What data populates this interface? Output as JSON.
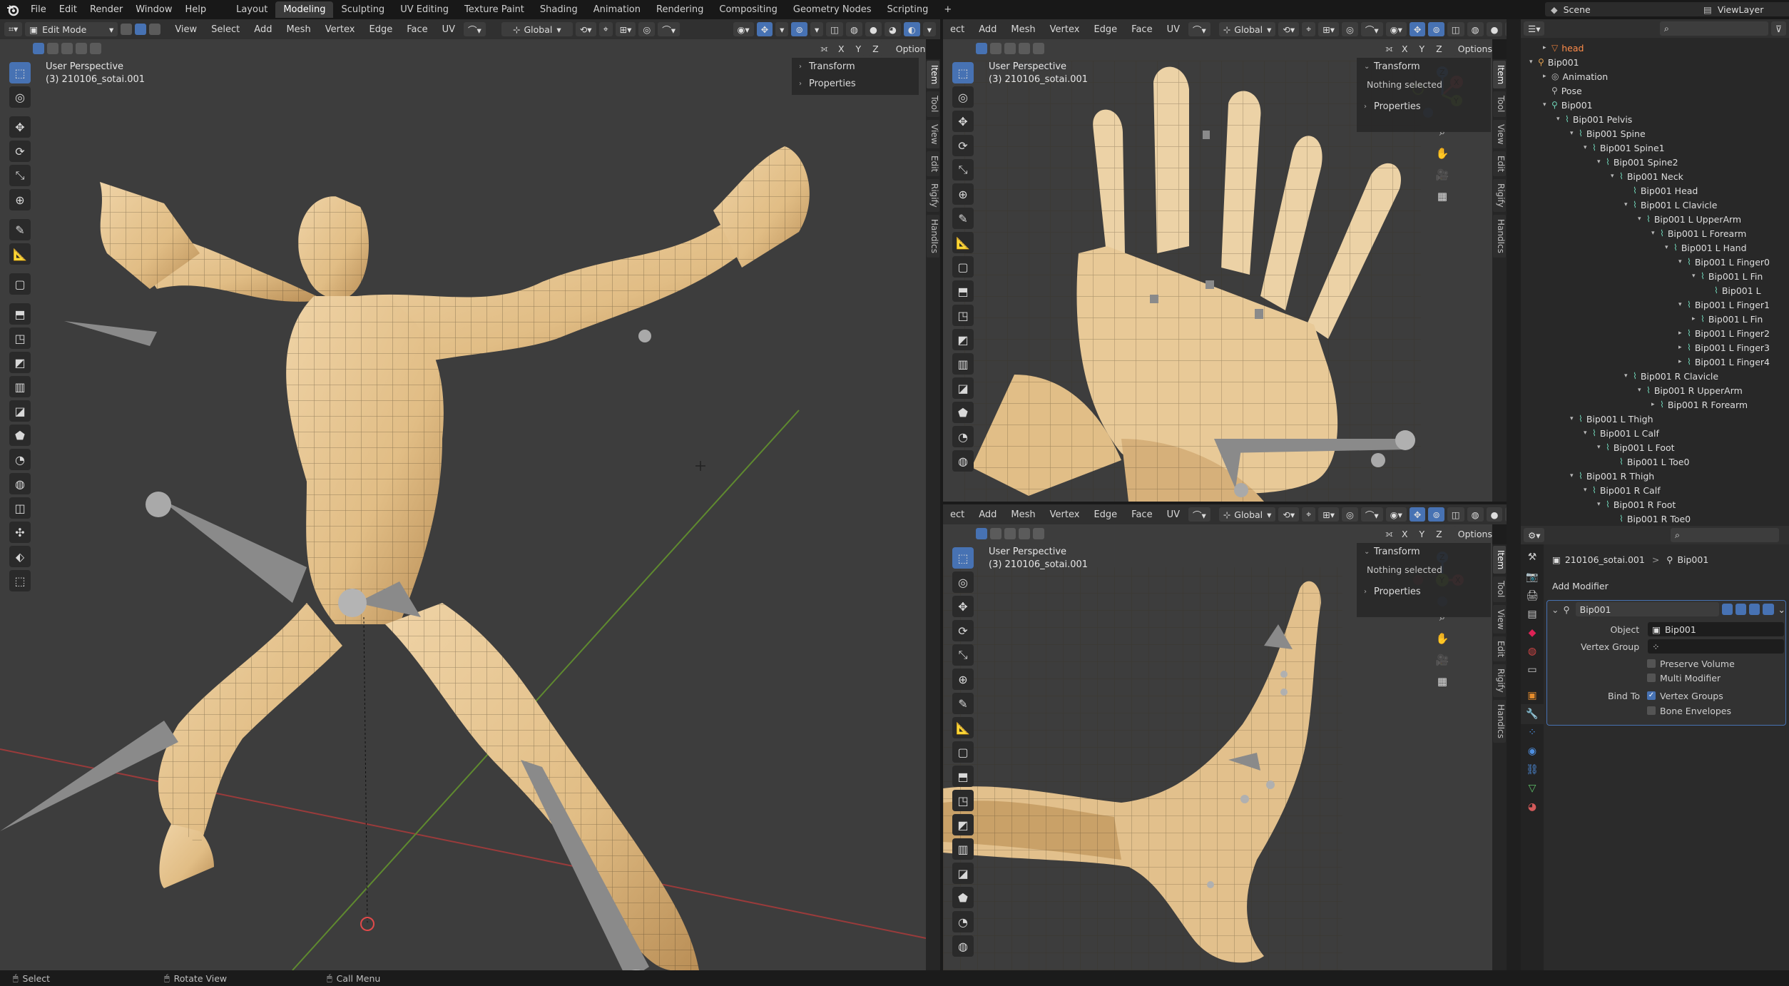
{
  "topbar": {
    "menus": [
      "File",
      "Edit",
      "Render",
      "Window",
      "Help"
    ],
    "workspaces": [
      "Layout",
      "Modeling",
      "Sculpting",
      "UV Editing",
      "Texture Paint",
      "Shading",
      "Animation",
      "Rendering",
      "Compositing",
      "Geometry Nodes",
      "Scripting"
    ],
    "active_workspace": "Modeling",
    "add_tab": "+",
    "scene": "Scene",
    "view_layer": "ViewLayer"
  },
  "main_view": {
    "mode": "Edit Mode",
    "menus": [
      "View",
      "Select",
      "Add",
      "Mesh",
      "Vertex",
      "Edge",
      "Face",
      "UV"
    ],
    "orientation": "Global",
    "axes": [
      "X",
      "Y",
      "Z"
    ],
    "options": "Options",
    "perspective": "User Perspective",
    "object": "(3) 210106_sotai.001",
    "panel": {
      "transform": "Transform",
      "properties": "Properties"
    }
  },
  "side_tabs": [
    "Item",
    "Tool",
    "View",
    "Edit",
    "Rigify",
    "HandIcs"
  ],
  "top_right_view": {
    "menus": [
      "ect",
      "Add",
      "Mesh",
      "Vertex",
      "Edge",
      "Face",
      "UV"
    ],
    "orientation": "Global",
    "axes": [
      "X",
      "Y",
      "Z"
    ],
    "options": "Options",
    "perspective": "User Perspective",
    "object": "(3) 210106_sotai.001",
    "panel": {
      "transform": "Transform",
      "nothing": "Nothing selected",
      "properties": "Properties"
    }
  },
  "bottom_right_view": {
    "menus": [
      "ect",
      "Add",
      "Mesh",
      "Vertex",
      "Edge",
      "Face",
      "UV"
    ],
    "orientation": "Global",
    "axes": [
      "X",
      "Y",
      "Z"
    ],
    "options": "Options",
    "perspective": "User Perspective",
    "object": "(3) 210106_sotai.001",
    "panel": {
      "transform": "Transform",
      "nothing": "Nothing selected",
      "properties": "Properties"
    }
  },
  "gizmo": {
    "x": "X",
    "y": "Y",
    "z": "Z"
  },
  "outliner": {
    "rows": [
      {
        "label": "head",
        "indent": 1,
        "type": "mesh",
        "tri": "▸"
      },
      {
        "label": "Bip001",
        "indent": 0,
        "type": "armature",
        "tri": "▾"
      },
      {
        "label": "Animation",
        "indent": 1,
        "type": "anim",
        "tri": "▸"
      },
      {
        "label": "Pose",
        "indent": 1,
        "type": "pose",
        "tri": ""
      },
      {
        "label": "Bip001",
        "indent": 1,
        "type": "armdata",
        "tri": "▾"
      },
      {
        "label": "Bip001 Pelvis",
        "indent": 2,
        "type": "bone",
        "tri": "▾"
      },
      {
        "label": "Bip001 Spine",
        "indent": 3,
        "type": "bone",
        "tri": "▾"
      },
      {
        "label": "Bip001 Spine1",
        "indent": 4,
        "type": "bone",
        "tri": "▾"
      },
      {
        "label": "Bip001 Spine2",
        "indent": 5,
        "type": "bone",
        "tri": "▾"
      },
      {
        "label": "Bip001 Neck",
        "indent": 6,
        "type": "bone",
        "tri": "▾"
      },
      {
        "label": "Bip001 Head",
        "indent": 7,
        "type": "bone",
        "tri": ""
      },
      {
        "label": "Bip001 L Clavicle",
        "indent": 7,
        "type": "bone",
        "tri": "▾"
      },
      {
        "label": "Bip001 L UpperArm",
        "indent": 8,
        "type": "bone",
        "tri": "▾"
      },
      {
        "label": "Bip001 L Forearm",
        "indent": 9,
        "type": "bone",
        "tri": "▾"
      },
      {
        "label": "Bip001 L Hand",
        "indent": 10,
        "type": "bone",
        "tri": "▾"
      },
      {
        "label": "Bip001 L Finger0",
        "indent": 11,
        "type": "bone",
        "tri": "▾"
      },
      {
        "label": "Bip001 L Fin",
        "indent": 12,
        "type": "bone",
        "tri": "▾"
      },
      {
        "label": "Bip001 L",
        "indent": 13,
        "type": "bone",
        "tri": ""
      },
      {
        "label": "Bip001 L Finger1",
        "indent": 11,
        "type": "bone",
        "tri": "▾"
      },
      {
        "label": "Bip001 L Fin",
        "indent": 12,
        "type": "bone",
        "tri": "▸"
      },
      {
        "label": "Bip001 L Finger2",
        "indent": 11,
        "type": "bone",
        "tri": "▸"
      },
      {
        "label": "Bip001 L Finger3",
        "indent": 11,
        "type": "bone",
        "tri": "▸"
      },
      {
        "label": "Bip001 L Finger4",
        "indent": 11,
        "type": "bone",
        "tri": "▸"
      },
      {
        "label": "Bip001 R Clavicle",
        "indent": 7,
        "type": "bone",
        "tri": "▾"
      },
      {
        "label": "Bip001 R UpperArm",
        "indent": 8,
        "type": "bone",
        "tri": "▾"
      },
      {
        "label": "Bip001 R Forearm",
        "indent": 9,
        "type": "bone",
        "tri": "▸"
      },
      {
        "label": "Bip001 L Thigh",
        "indent": 3,
        "type": "bone",
        "tri": "▾"
      },
      {
        "label": "Bip001 L Calf",
        "indent": 4,
        "type": "bone",
        "tri": "▾"
      },
      {
        "label": "Bip001 L Foot",
        "indent": 5,
        "type": "bone",
        "tri": "▾"
      },
      {
        "label": "Bip001 L Toe0",
        "indent": 6,
        "type": "bone",
        "tri": ""
      },
      {
        "label": "Bip001 R Thigh",
        "indent": 3,
        "type": "bone",
        "tri": "▾"
      },
      {
        "label": "Bip001 R Calf",
        "indent": 4,
        "type": "bone",
        "tri": "▾"
      },
      {
        "label": "Bip001 R Foot",
        "indent": 5,
        "type": "bone",
        "tri": "▾"
      },
      {
        "label": "Bip001 R Toe0",
        "indent": 6,
        "type": "bone",
        "tri": ""
      }
    ]
  },
  "properties": {
    "breadcrumb_object": "210106_sotai.001",
    "breadcrumb_sep": ">",
    "breadcrumb_armature": "Bip001",
    "add_modifier": "Add Modifier",
    "modifier_name": "Bip001",
    "object_label": "Object",
    "object_value": "Bip001",
    "vertex_group_label": "Vertex Group",
    "preserve_volume": "Preserve Volume",
    "multi_modifier": "Multi Modifier",
    "bind_to_label": "Bind To",
    "vertex_groups": "Vertex Groups",
    "bone_envelopes": "Bone Envelopes"
  },
  "status": {
    "select": "Select",
    "rotate": "Rotate View",
    "menu": "Call Menu"
  },
  "colors": {
    "accent": "#4772b3",
    "skin": "#e2c190",
    "bg": "#3d3d3d",
    "axis_x": "#d24a5a",
    "axis_y": "#7fb23a",
    "axis_z": "#3e7fd6"
  }
}
